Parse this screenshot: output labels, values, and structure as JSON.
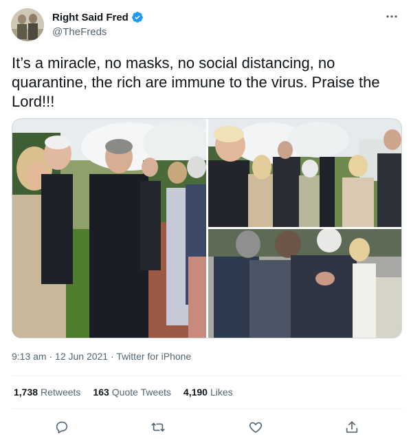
{
  "author": {
    "name": "Right Said Fred",
    "handle": "@TheFreds",
    "verified": true,
    "avatar_icon": "avatar-photo"
  },
  "tweet": {
    "text": "It’s a miracle, no masks, no social distancing, no quarantine, the rich are immune to the virus. Praise the Lord!!!",
    "time": "9:13 am · 12 Jun 2021 · Twitter for iPhone"
  },
  "stats": {
    "retweets_count": "1,738",
    "retweets_label": "Retweets",
    "quotes_count": "163",
    "quotes_label": "Quote Tweets",
    "likes_count": "4,190",
    "likes_label": "Likes"
  },
  "icons": {
    "more": "more-icon",
    "verified": "verified-badge-icon",
    "reply": "reply-icon",
    "retweet": "retweet-icon",
    "like": "like-icon",
    "share": "share-icon"
  },
  "colors": {
    "text": "#0f1419",
    "secondary": "#536471",
    "verified": "#1d9bf0",
    "border": "#cfd9de"
  }
}
